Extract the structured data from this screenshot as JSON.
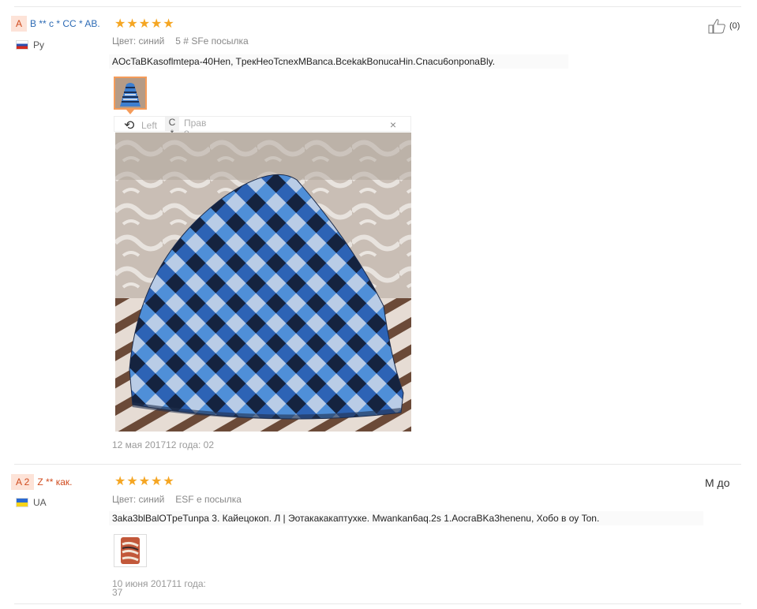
{
  "reviews": [
    {
      "avatar_letter": "A",
      "user_name": "B ** c * CC * AB.",
      "country": "Ру",
      "stars": 5,
      "color_label": "Цвет: синий",
      "shipping": "5 # SFe посылка",
      "text": "AOcTaBKasoflmtepa-40Hen, TpeкHeoTcnexMBanca.BcekakBonucaHin.Cnacu6onponaBly.",
      "date": "12 мая 201712 года: 02",
      "likes": "(0)",
      "viewer": {
        "left": "Left",
        "c": "C",
        "c2": "*",
        "prav": "Прав",
        "prav2": "о",
        "close": "×"
      }
    },
    {
      "avatar_letter": "A 2",
      "user_name": "Z ** как.",
      "country": "UA",
      "stars": 5,
      "color_label": "Цвет: синий",
      "shipping": "ESF е посылка",
      "text": "3aka3blBalOTpeTunpa 3. Кайецокоп. Л | Эотакакакаптухке. Mwankan6aq.2s 1.AocraBKa3henenu, Хобо в оу Ton.",
      "date_line1": "10 июня 201711 года:",
      "date_line2": "37",
      "likes": "М до"
    }
  ],
  "colors": {
    "star": "#f5a623",
    "thumb_border": "#f59c5a",
    "name_blue": "#2d6bb5",
    "name_orange": "#d04b1e"
  }
}
